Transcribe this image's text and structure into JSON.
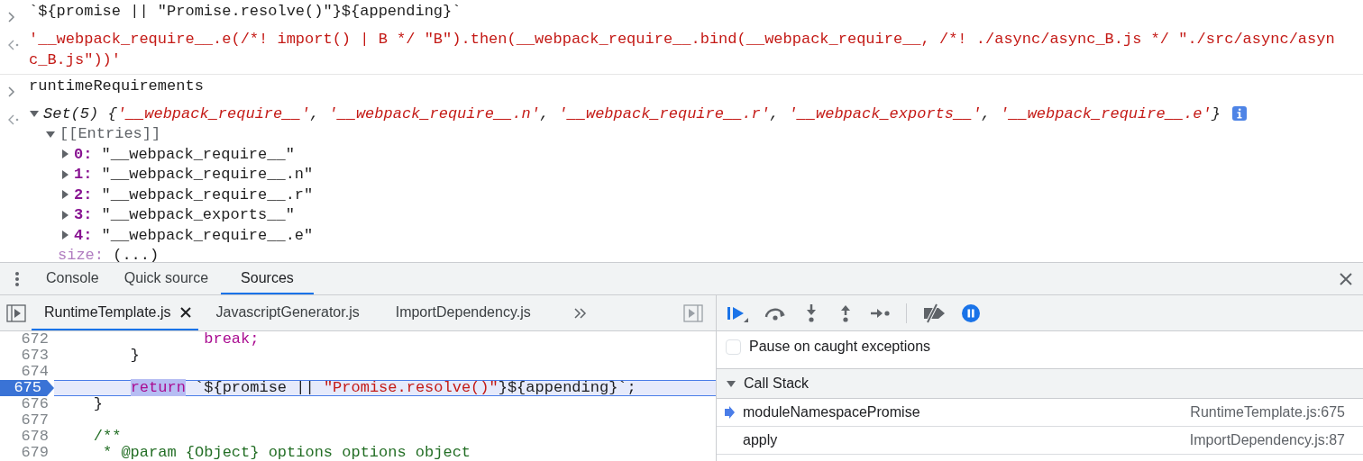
{
  "console": {
    "entries": [
      {
        "kind": "input",
        "tokens": [
          {
            "text": "`${promise || \"Promise.resolve()\"}${appending}`",
            "kind": "plain"
          }
        ]
      },
      {
        "kind": "output",
        "tokens": [
          {
            "text": "'__webpack_require__.e(/*! import() | B */ \"B\").then(__webpack_require__.bind(__webpack_require__, /*! ./async/async_B.js */ \"./src/async/async_B.js\"))'",
            "kind": "string"
          }
        ]
      },
      {
        "kind": "input",
        "tokens": [
          {
            "text": "runtimeRequirements",
            "kind": "plain"
          }
        ]
      },
      {
        "kind": "object",
        "expanded": true,
        "tokens": [
          {
            "text": "Set(5) {",
            "kind": "plain"
          },
          {
            "text": "'__webpack_require__'",
            "kind": "string"
          },
          {
            "text": ", ",
            "kind": "plain"
          },
          {
            "text": "'__webpack_require__.n'",
            "kind": "string"
          },
          {
            "text": ", ",
            "kind": "plain"
          },
          {
            "text": "'__webpack_require__.r'",
            "kind": "string"
          },
          {
            "text": ", ",
            "kind": "plain"
          },
          {
            "text": "'__webpack_exports__'",
            "kind": "string"
          },
          {
            "text": ", ",
            "kind": "plain"
          },
          {
            "text": "'__webpack_require__.e'",
            "kind": "string"
          },
          {
            "text": "}",
            "kind": "plain"
          }
        ],
        "children": [
          {
            "kind": "group",
            "label": "[[Entries]]",
            "expanded": true,
            "children": [
              {
                "key": "0:",
                "value": "\"__webpack_require__\"",
                "expanded": false
              },
              {
                "key": "1:",
                "value": "\"__webpack_require__.n\"",
                "expanded": false
              },
              {
                "key": "2:",
                "value": "\"__webpack_require__.r\"",
                "expanded": false
              },
              {
                "key": "3:",
                "value": "\"__webpack_exports__\"",
                "expanded": false
              },
              {
                "key": "4:",
                "value": "\"__webpack_require__.e\"",
                "expanded": false
              }
            ]
          },
          {
            "kind": "property",
            "key": "size:",
            "value": "(...)"
          }
        ]
      }
    ]
  },
  "drawer": {
    "tabs": [
      {
        "label": "Console",
        "selected": false
      },
      {
        "label": "Quick source",
        "selected": false
      },
      {
        "label": "Sources",
        "selected": true
      }
    ]
  },
  "editor": {
    "files": [
      {
        "label": "RuntimeTemplate.js",
        "selected": true
      },
      {
        "label": "JavascriptGenerator.js",
        "selected": false
      },
      {
        "label": "ImportDependency.js",
        "selected": false
      }
    ],
    "lines": [
      {
        "number": "672",
        "current": false,
        "tokens": [
          {
            "text": "                break;",
            "kind": "keyword"
          }
        ]
      },
      {
        "number": "673",
        "current": false,
        "tokens": [
          {
            "text": "        }",
            "kind": "plain"
          }
        ]
      },
      {
        "number": "674",
        "current": false
      },
      {
        "number": "675",
        "current": true,
        "tokens": [
          {
            "text": "        return",
            "kind": "highlight"
          },
          {
            "text": " `${promise || ",
            "kind": "plain"
          },
          {
            "text": "\"Promise.resolve()\"",
            "kind": "string"
          },
          {
            "text": "}${appending}`;",
            "kind": "plain"
          }
        ]
      },
      {
        "number": "676",
        "current": false,
        "tokens": [
          {
            "text": "    }",
            "kind": "plain"
          }
        ]
      },
      {
        "number": "677",
        "current": false
      },
      {
        "number": "678",
        "current": false,
        "tokens": [
          {
            "text": "    /**",
            "kind": "comment"
          }
        ]
      },
      {
        "number": "679",
        "current": false,
        "tokens": [
          {
            "text": "     * @param {Object} options options object",
            "kind": "comment"
          }
        ]
      }
    ]
  },
  "debugger": {
    "pause_on_caught": {
      "label": "Pause on caught exceptions",
      "checked": false
    },
    "call_stack": {
      "title": "Call Stack",
      "expanded": true,
      "frames": [
        {
          "name": "moduleNamespacePromise",
          "location": "RuntimeTemplate.js:675",
          "selected": true
        },
        {
          "name": "apply",
          "location": "ImportDependency.js:87",
          "selected": false
        }
      ]
    }
  }
}
